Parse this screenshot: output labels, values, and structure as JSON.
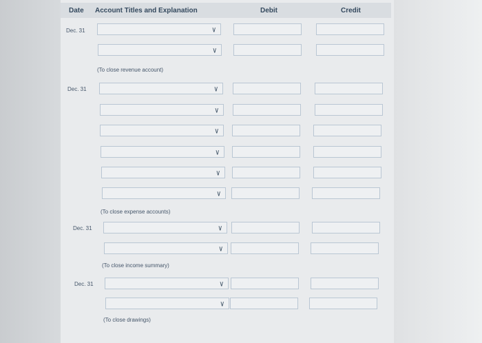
{
  "header": {
    "date": "Date",
    "account": "Account Titles and Explanation",
    "debit": "Debit",
    "credit": "Credit"
  },
  "entries": [
    {
      "date": "Dec. 31",
      "note": "(To close revenue account)"
    },
    {
      "date": "Dec. 31",
      "note": "(To close expense accounts)"
    },
    {
      "date": "Dec. 31",
      "note": "(To close income summary)"
    },
    {
      "date": "Dec. 31",
      "note": "(To close drawings)"
    }
  ],
  "icons": {
    "dropdown": "chevron-down-icon"
  }
}
